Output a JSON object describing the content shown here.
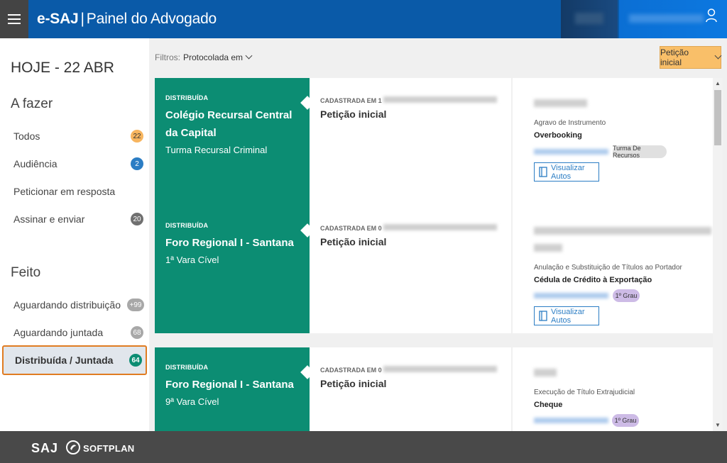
{
  "header": {
    "app_brand": "e-SAJ",
    "separator": "|",
    "app_subtitle": "Painel do Advogado"
  },
  "sidebar": {
    "today": "HOJE - 22 ABR",
    "todo_title": "A fazer",
    "todo_items": [
      {
        "label": "Todos",
        "count": "22"
      },
      {
        "label": "Audiência",
        "count": "2"
      },
      {
        "label": "Peticionar em resposta",
        "count": ""
      },
      {
        "label": "Assinar e enviar",
        "count": "20"
      }
    ],
    "done_title": "Feito",
    "done_items": [
      {
        "label": "Aguardando distribuição",
        "count": "+99"
      },
      {
        "label": "Aguardando juntada",
        "count": "68"
      },
      {
        "label": "Distribuída / Juntada",
        "count": "64"
      }
    ]
  },
  "filters": {
    "label": "Filtros:",
    "value": "Protocolada em"
  },
  "peticao_button": "Petição inicial",
  "cards": [
    {
      "status": "DISTRIBUÍDA",
      "court": "Colégio Recursal Central da Capital",
      "division": "Turma Recursal Criminal",
      "registered_label": "CADASTRADA EM 1",
      "petition_type": "Petição inicial",
      "class": "Agravo de Instrumento",
      "subject": "Overbooking",
      "tag": "Turma De Recursos",
      "view_label": "Visualizar Autos"
    },
    {
      "status": "DISTRIBUÍDA",
      "court": "Foro Regional I - Santana",
      "division": "1ª Vara Cível",
      "registered_label": "CADASTRADA EM 0",
      "petition_type": "Petição inicial",
      "class": "Anulação e Substituição de Títulos ao Portador",
      "subject": "Cédula de Crédito à Exportação",
      "tag": "1º Grau",
      "view_label": "Visualizar Autos"
    },
    {
      "status": "DISTRIBUÍDA",
      "court": "Foro Regional I - Santana",
      "division": "9ª Vara Cível",
      "registered_label": "CADASTRADA EM 0",
      "petition_type": "Petição inicial",
      "class": "Execução de Título Extrajudicial",
      "subject": "Cheque",
      "tag": "1º Grau",
      "view_label": ""
    }
  ],
  "footer": {
    "saj": "SAJ",
    "softplan": "SOFTPLAN"
  },
  "colors": {
    "header_blue": "#0a5aa8",
    "card_green": "#0c8d73",
    "accent_orange": "#f9bf69",
    "active_outline": "#e07c22"
  }
}
